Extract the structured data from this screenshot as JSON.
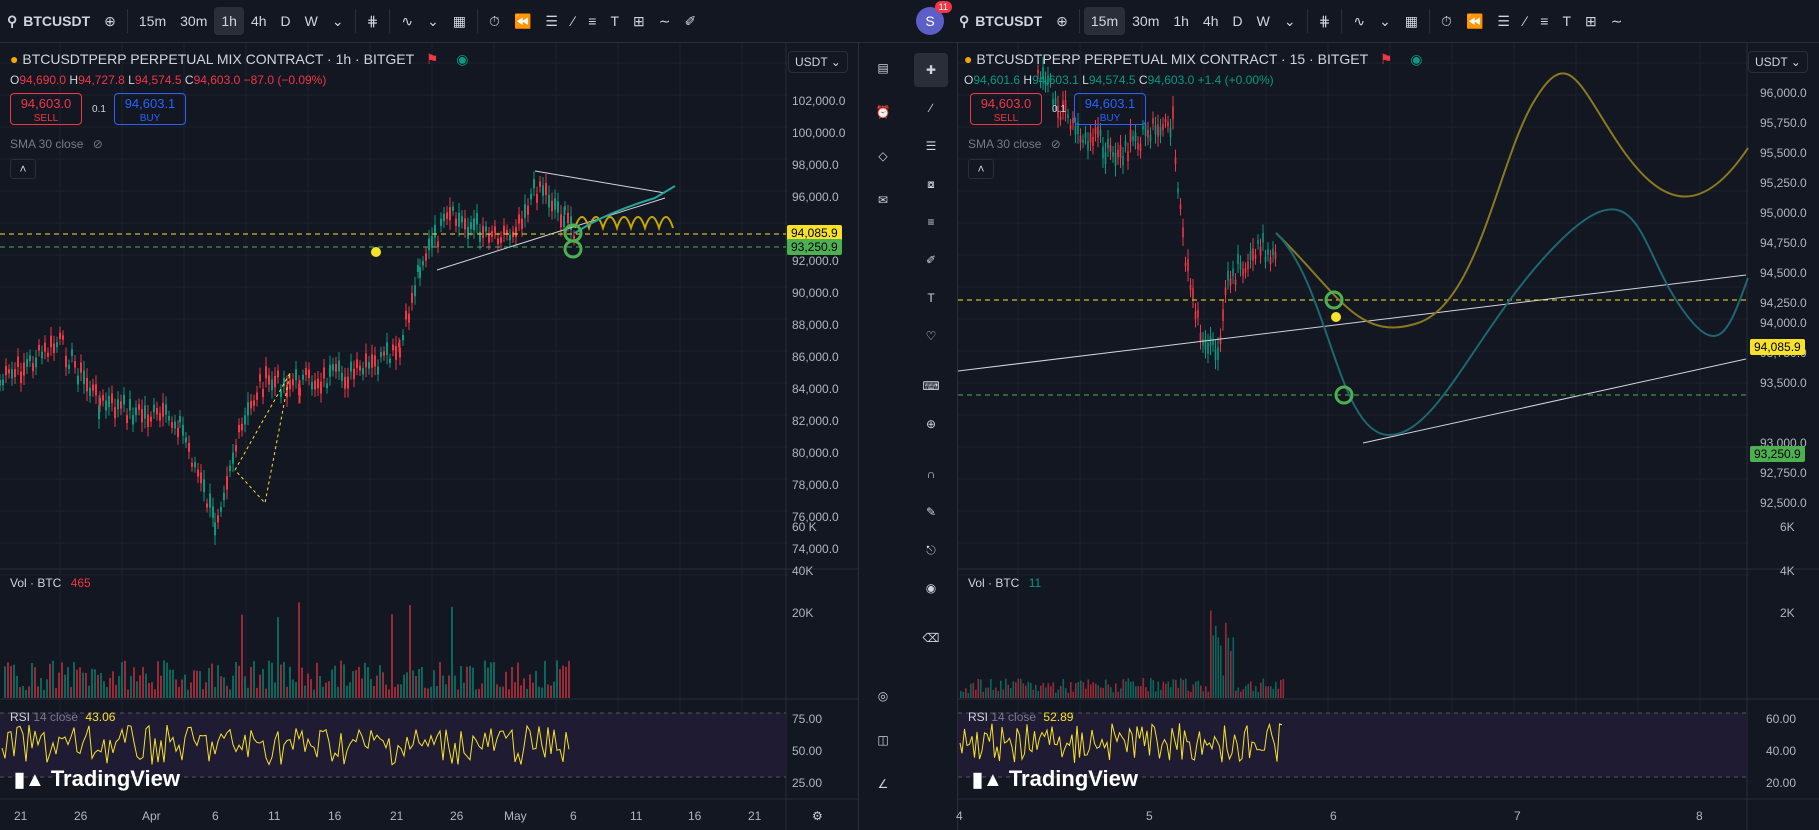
{
  "left": {
    "toolbar": {
      "symbol": "BTCUSDT",
      "intervals": [
        "15m",
        "30m",
        "1h",
        "4h",
        "D",
        "W"
      ],
      "active_interval": "1h"
    },
    "legend": {
      "title": "BTCUSDTPERP PERPETUAL MIX CONTRACT · 1h · BITGET",
      "ohlc": {
        "o": "94,690.0",
        "h": "94,727.8",
        "l": "94,574.5",
        "c": "94,603.0",
        "chg": "−87.0 (−0.09%)"
      },
      "sell_price": "94,603.0",
      "sell_label": "SELL",
      "spread": "0.1",
      "buy_price": "94,603.1",
      "buy_label": "BUY",
      "sma": "SMA 30 close"
    },
    "currency": "USDT",
    "price_axis": [
      "102,000.0",
      "100,000.0",
      "98,000.0",
      "96,000.0",
      "92,000.0",
      "90,000.0",
      "88,000.0",
      "86,000.0",
      "84,000.0",
      "82,000.0",
      "80,000.0",
      "78,000.0",
      "76,000.0",
      "74,000.0"
    ],
    "price_tags": {
      "yellow": "94,085.9",
      "green": "93,250.9"
    },
    "vol": {
      "label": "Vol · BTC",
      "value": "465",
      "axis": [
        "60 K",
        "40K",
        "20K"
      ]
    },
    "rsi": {
      "label": "RSI",
      "params": "14 close",
      "value": "43.06",
      "axis": [
        "75.00",
        "50.00",
        "25.00"
      ]
    },
    "time_axis": [
      "21",
      "26",
      "Apr",
      "6",
      "11",
      "16",
      "21",
      "26",
      "May",
      "6",
      "11",
      "16",
      "21"
    ],
    "watermark": "TradingView"
  },
  "right": {
    "toolbar": {
      "avatar": "S",
      "badge": "11",
      "symbol": "BTCUSDT",
      "intervals": [
        "15m",
        "30m",
        "1h",
        "4h",
        "D",
        "W"
      ],
      "active_interval": "15m"
    },
    "legend": {
      "title": "BTCUSDTPERP PERPETUAL MIX CONTRACT · 15 · BITGET",
      "ohlc": {
        "o": "94,601.6",
        "h": "94,603.1",
        "l": "94,574.5",
        "c": "94,603.0",
        "chg": "+1.4 (+0.00%)"
      },
      "sell_price": "94,603.0",
      "sell_label": "SELL",
      "spread": "0.1",
      "buy_price": "94,603.1",
      "buy_label": "BUY",
      "sma": "SMA 30 close"
    },
    "currency": "USDT",
    "price_axis": [
      "96,000.0",
      "95,750.0",
      "95,500.0",
      "95,250.0",
      "95,000.0",
      "94,750.0",
      "94,500.0",
      "94,250.0",
      "94,000.0",
      "93,750.0",
      "93,500.0",
      "93,000.0",
      "92,750.0",
      "92,500.0"
    ],
    "price_tags": {
      "yellow": "94,085.9",
      "green": "93,250.9"
    },
    "vol": {
      "label": "Vol · BTC",
      "value": "11",
      "axis": [
        "6K",
        "4K",
        "2K"
      ]
    },
    "rsi": {
      "label": "RSI",
      "params": "14 close",
      "value": "52.89",
      "axis": [
        "60.00",
        "40.00",
        "20.00"
      ]
    },
    "time_axis": [
      "4",
      "5",
      "6",
      "7",
      "8"
    ],
    "watermark": "TradingView"
  },
  "colors": {
    "bg": "#131722",
    "up": "#089981",
    "down": "#f23645",
    "yellow": "#f7e22b",
    "green": "#4caf50",
    "rsi": "#f7e22b"
  }
}
